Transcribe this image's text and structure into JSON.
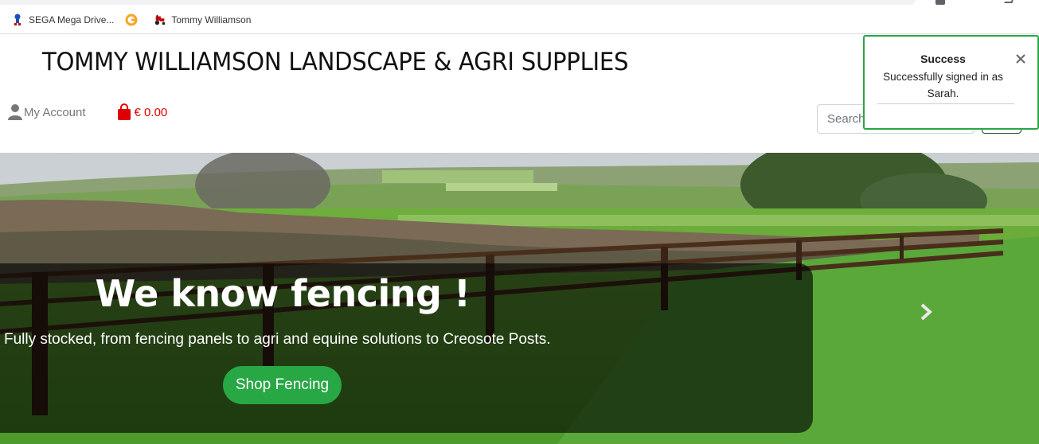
{
  "bookmarks": [
    {
      "label": "SEGA Mega Drive...",
      "icon": "sega-icon"
    },
    {
      "label": "",
      "icon": "grammarly-icon"
    },
    {
      "label": "Tommy Williamson",
      "icon": "tractor-icon"
    }
  ],
  "header": {
    "title": "TOMMY WILLIAMSON LANDSCAPE & AGRI SUPPLIES",
    "account_label": "My Account",
    "cart_total": "€ 0.00",
    "search_placeholder": "Search"
  },
  "toast": {
    "title": "Success",
    "message": "Successfully signed in as Sarah.",
    "border_color": "#28a745"
  },
  "hero": {
    "headline": "We know fencing !",
    "subline": "Fully stocked, from fencing panels to agri and equine solutions to Creosote Posts.",
    "cta_label": "Shop Fencing",
    "cta_color": "#28a745"
  }
}
